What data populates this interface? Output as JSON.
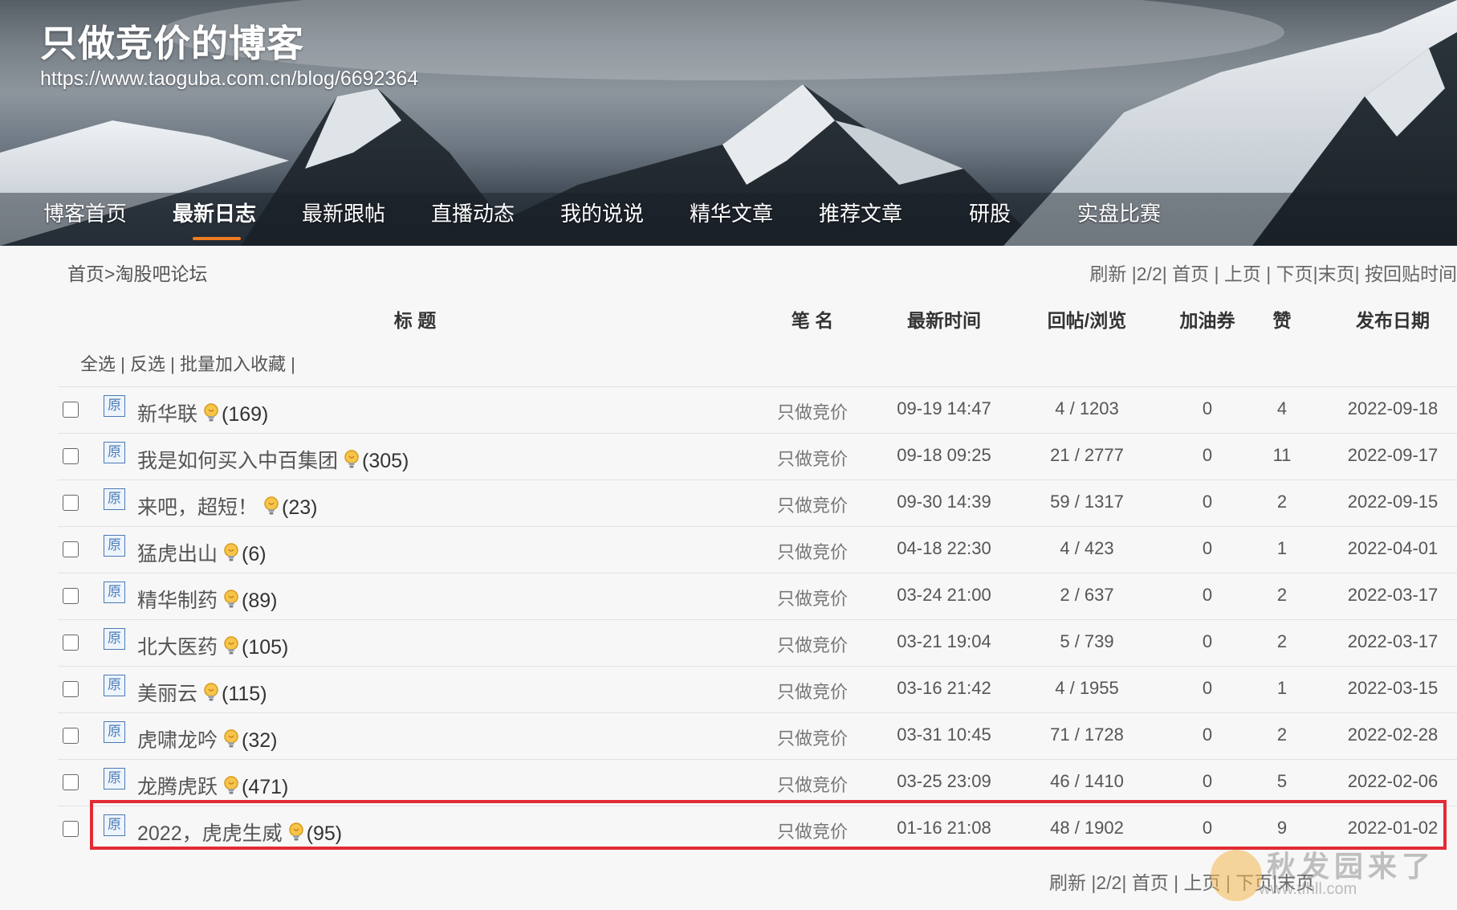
{
  "header": {
    "blog_title": "只做竞价的博客",
    "blog_url": "https://www.taoguba.com.cn/blog/6692364"
  },
  "nav": {
    "items": [
      {
        "label": "博客首页"
      },
      {
        "label": "最新日志"
      },
      {
        "label": "最新跟帖"
      },
      {
        "label": "直播动态"
      },
      {
        "label": "我的说说"
      },
      {
        "label": "精华文章"
      },
      {
        "label": "推荐文章"
      },
      {
        "label": "研股"
      },
      {
        "label": "实盘比赛"
      }
    ],
    "active_index": 1,
    "accent_color": "#ee7b22"
  },
  "breadcrumb": {
    "home": "首页",
    "separator": ">",
    "current": "淘股吧论坛"
  },
  "pager_top": {
    "refresh": "刷新",
    "page_info": "|2/2|",
    "first": "首页",
    "prev": "上页",
    "next": "下页",
    "last": "末页",
    "sort": "按回贴时间"
  },
  "pager_bottom": {
    "refresh": "刷新",
    "page_info": "|2/2|",
    "first": "首页",
    "prev": "上页",
    "next": "下页",
    "last": "末页"
  },
  "table": {
    "headers": {
      "title": "标 题",
      "author": "笔 名",
      "latest": "最新时间",
      "replies": "回帖/浏览",
      "coupon": "加油券",
      "likes": "赞",
      "date": "发布日期"
    },
    "bulk_actions": {
      "select_all": "全选",
      "invert": "反选",
      "batch_fav": "批量加入收藏"
    },
    "original_badge": "原",
    "rows": [
      {
        "title": "新华联",
        "count": "(169)",
        "author": "只做竞价",
        "latest": "09-19 14:47",
        "replies": "4 / 1203",
        "coupon": "0",
        "likes": "4",
        "date": "2022-09-18"
      },
      {
        "title": "我是如何买入中百集团",
        "count": "(305)",
        "author": "只做竞价",
        "latest": "09-18 09:25",
        "replies": "21 / 2777",
        "coupon": "0",
        "likes": "11",
        "date": "2022-09-17"
      },
      {
        "title": "来吧，超短！",
        "count": "(23)",
        "author": "只做竞价",
        "latest": "09-30 14:39",
        "replies": "59 / 1317",
        "coupon": "0",
        "likes": "2",
        "date": "2022-09-15"
      },
      {
        "title": "猛虎出山",
        "count": "(6)",
        "author": "只做竞价",
        "latest": "04-18 22:30",
        "replies": "4 / 423",
        "coupon": "0",
        "likes": "1",
        "date": "2022-04-01"
      },
      {
        "title": "精华制药",
        "count": "(89)",
        "author": "只做竞价",
        "latest": "03-24 21:00",
        "replies": "2 / 637",
        "coupon": "0",
        "likes": "2",
        "date": "2022-03-17"
      },
      {
        "title": "北大医药",
        "count": "(105)",
        "author": "只做竞价",
        "latest": "03-21 19:04",
        "replies": "5 / 739",
        "coupon": "0",
        "likes": "2",
        "date": "2022-03-17"
      },
      {
        "title": "美丽云",
        "count": "(115)",
        "author": "只做竞价",
        "latest": "03-16 21:42",
        "replies": "4 / 1955",
        "coupon": "0",
        "likes": "1",
        "date": "2022-03-15"
      },
      {
        "title": "虎啸龙吟",
        "count": "(32)",
        "author": "只做竞价",
        "latest": "03-31 10:45",
        "replies": "71 / 1728",
        "coupon": "0",
        "likes": "2",
        "date": "2022-02-28"
      },
      {
        "title": "龙腾虎跃",
        "count": "(471)",
        "author": "只做竞价",
        "latest": "03-25 23:09",
        "replies": "46 / 1410",
        "coupon": "0",
        "likes": "5",
        "date": "2022-02-06"
      },
      {
        "title": "2022，虎虎生威",
        "count": "(95)",
        "author": "只做竞价",
        "latest": "01-16 21:08",
        "replies": "48 / 1902",
        "coupon": "0",
        "likes": "9",
        "date": "2022-01-02"
      }
    ]
  },
  "highlight_color": "#e22b35",
  "watermark": {
    "line1": "秋发园来了",
    "line2": "www.tfhll.com"
  }
}
